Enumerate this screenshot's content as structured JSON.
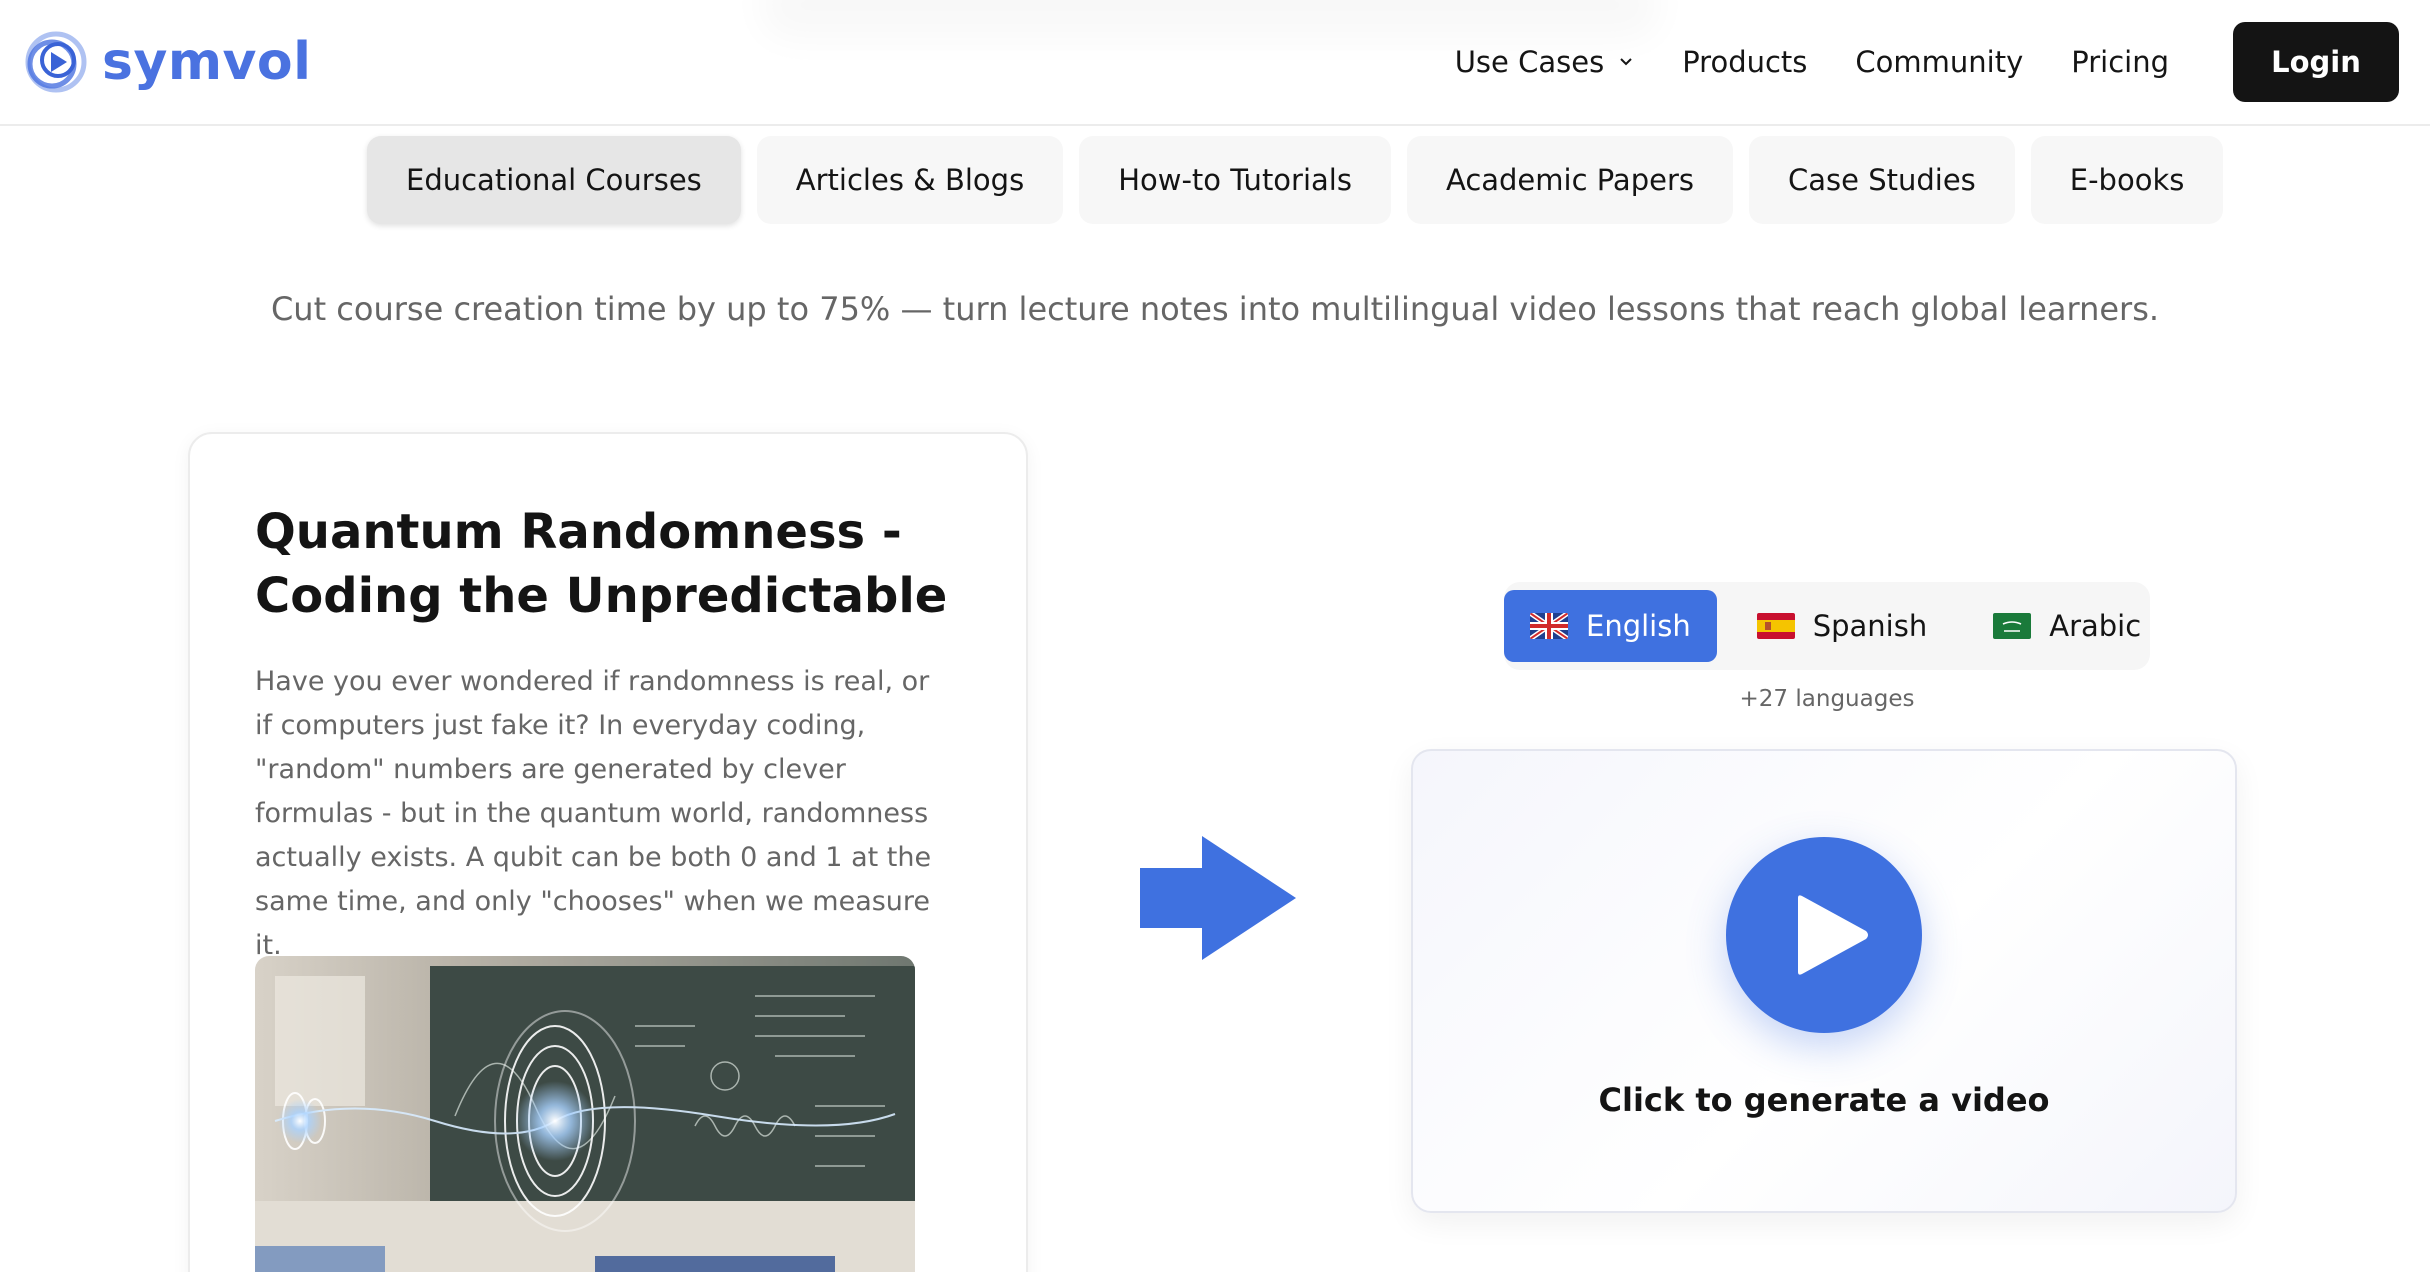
{
  "brand": {
    "name": "symvol",
    "logo_icon": "symvol-logo-icon",
    "accent_color": "#3f71e0"
  },
  "nav": {
    "items": [
      {
        "label": "Use Cases",
        "has_dropdown": true
      },
      {
        "label": "Products"
      },
      {
        "label": "Community"
      },
      {
        "label": "Pricing"
      }
    ],
    "login_label": "Login"
  },
  "categories": {
    "tabs": [
      {
        "label": "Educational Courses",
        "active": true
      },
      {
        "label": "Articles & Blogs"
      },
      {
        "label": "How-to Tutorials"
      },
      {
        "label": "Academic Papers"
      },
      {
        "label": "Case Studies"
      },
      {
        "label": "E-books"
      }
    ],
    "tagline": "Cut course creation time by up to 75% — turn lecture notes into multilingual video lessons that reach global learners."
  },
  "article": {
    "title": "Quantum Randomness - Coding the Unpredictable",
    "body": "Have you ever wondered if randomness is real, or if computers just fake it? In everyday coding, \"random\" numbers are generated by clever formulas - but in the quantum world, randomness actually exists. A qubit can be both 0 and 1 at the same time, and only \"chooses\" when we measure it."
  },
  "languages": {
    "options": [
      {
        "label": "English",
        "flag": "uk-flag-icon",
        "active": true
      },
      {
        "label": "Spanish",
        "flag": "spain-flag-icon"
      },
      {
        "label": "Arabic",
        "flag": "saudi-flag-icon"
      }
    ],
    "more": "+27 languages"
  },
  "video": {
    "caption": "Click to generate a video",
    "icon": "play-icon"
  }
}
